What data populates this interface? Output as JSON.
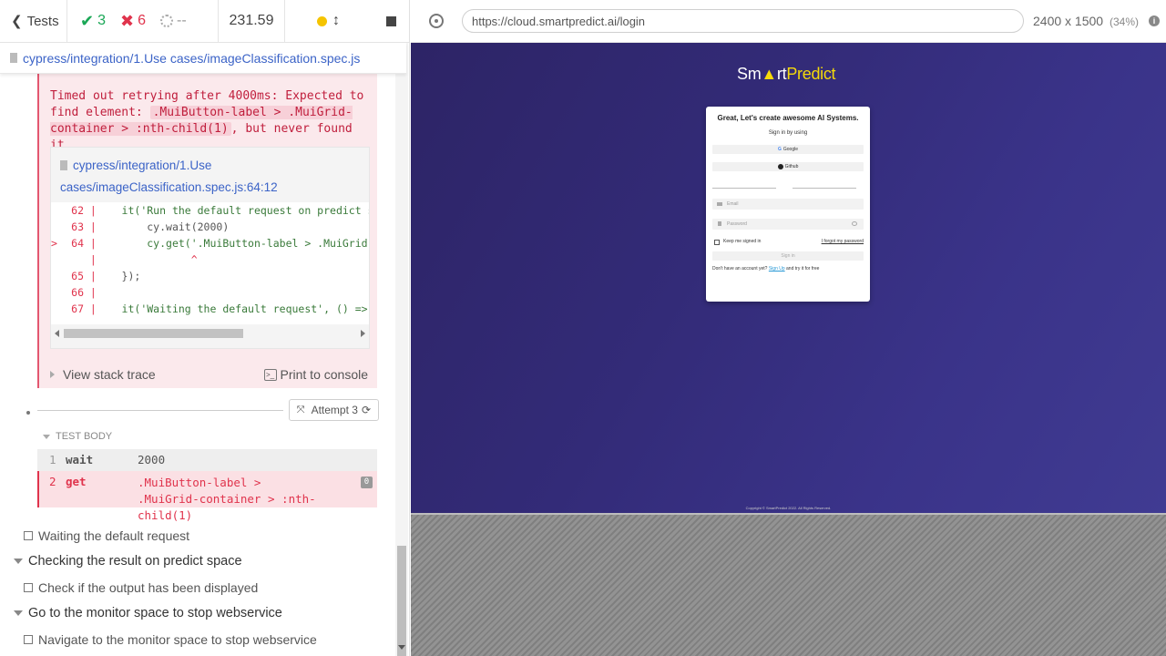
{
  "reporter": {
    "back_label": "Tests",
    "passed_count": "3",
    "failed_count": "6",
    "pending_count": "--",
    "duration": "231.59",
    "spec_path": "cypress/integration/1.Use cases/imageClassification.spec.js"
  },
  "error": {
    "message_prefix": "Timed out retrying after 4000ms: Expected to find element: ",
    "selector": ".MuiButton-label > .MuiGrid-container > :nth-child(1)",
    "message_suffix": ", but never found it.",
    "codeframe_path": "cypress/integration/1.Use cases/imageClassification.spec.js:64:12",
    "code_lines": [
      {
        "marker": "",
        "num": "62",
        "code": "    it('Run the default request on predict sp"
      },
      {
        "marker": "",
        "num": "63",
        "code": "        cy.wait(2000)"
      },
      {
        "marker": ">",
        "num": "64",
        "code": "        cy.get('.MuiButton-label > .MuiGrid-c"
      },
      {
        "marker": "",
        "num": "",
        "code": "               ^"
      },
      {
        "marker": "",
        "num": "65",
        "code": "    });"
      },
      {
        "marker": "",
        "num": "66",
        "code": ""
      },
      {
        "marker": "",
        "num": "67",
        "code": "    it('Waiting the default request', () => {"
      }
    ],
    "view_stack_trace": "View stack trace",
    "print_to_console": "Print to console"
  },
  "attempt": {
    "label": "Attempt 3"
  },
  "commands": {
    "section_title": "TEST BODY",
    "rows": [
      {
        "num": "1",
        "name": "wait",
        "message": "2000",
        "badge": ""
      },
      {
        "num": "2",
        "name": "get",
        "message": ".MuiButton-label > .MuiGrid-container > :nth-child(1)",
        "badge": "0"
      }
    ]
  },
  "tests": [
    {
      "type": "test",
      "label": "Waiting the default request"
    },
    {
      "type": "suite",
      "label": "Checking the result on predict space"
    },
    {
      "type": "test",
      "label": "Check if the output has been displayed"
    },
    {
      "type": "suite",
      "label": "Go to the monitor space to stop webservice"
    },
    {
      "type": "test",
      "label": "Navigate to the monitor space to stop webservice"
    }
  ],
  "aut": {
    "url": "https://cloud.smartpredict.ai/login",
    "viewport": "2400 x 1500",
    "zoom": "(34%)"
  },
  "login_page": {
    "logo_text_1": "Sm",
    "logo_text_2": "rt",
    "logo_text_3": "Predict",
    "heading": "Great, Let's create awesome AI Systems.",
    "signin_by": "Sign in by using",
    "google_label": "Google",
    "github_label": "Github",
    "email_placeholder": "Email",
    "password_placeholder": "Password",
    "keep_signed_in": "Keep me signed in",
    "forgot_password": "I forgot my password",
    "signin_button": "Sign in",
    "no_account": "Don't have an account yet?",
    "signup_link": "Sign Up",
    "try_free": "and try it for free",
    "copyright": "Copyright © SmartPredict 2022. All Rights Reserved."
  },
  "colors": {
    "passed": "#1aa756",
    "failed": "#e0334c",
    "link": "#3b63c7",
    "aut_bg": "#332b78",
    "logo_yellow": "#f5d90a"
  }
}
